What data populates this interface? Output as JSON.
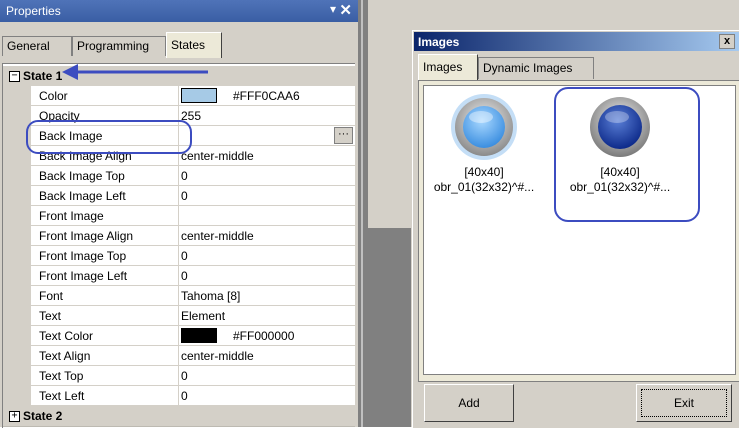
{
  "properties": {
    "title": "Properties",
    "pin_symbol": "▾",
    "close_symbol": "✕",
    "tabs": [
      {
        "label": "General"
      },
      {
        "label": "Programming"
      },
      {
        "label": "States"
      }
    ],
    "state1": {
      "label": "State 1",
      "toggle": "−",
      "rows": [
        {
          "name": "Color",
          "value": "#FFF0CAA6",
          "swatch": "#a6cae6"
        },
        {
          "name": "Opacity",
          "value": "255"
        },
        {
          "name": "Back Image",
          "value": "",
          "button": "···"
        },
        {
          "name": "Back Image Align",
          "value": "center-middle"
        },
        {
          "name": "Back Image Top",
          "value": "0"
        },
        {
          "name": "Back Image Left",
          "value": "0"
        },
        {
          "name": "Front Image",
          "value": ""
        },
        {
          "name": "Front Image Align",
          "value": "center-middle"
        },
        {
          "name": "Front Image Top",
          "value": "0"
        },
        {
          "name": "Front Image Left",
          "value": "0"
        },
        {
          "name": "Font",
          "value": "Tahoma [8]"
        },
        {
          "name": "Text",
          "value": "Element"
        },
        {
          "name": "Text Color",
          "value": "#FF000000",
          "swatch": "#000000"
        },
        {
          "name": "Text Align",
          "value": "center-middle"
        },
        {
          "name": "Text Top",
          "value": "0"
        },
        {
          "name": "Text Left",
          "value": "0"
        }
      ]
    },
    "state2": {
      "label": "State 2",
      "toggle": "+"
    }
  },
  "images": {
    "title": "Images",
    "close_symbol": "x",
    "tabs": [
      {
        "label": "Images"
      },
      {
        "label": "Dynamic Images"
      }
    ],
    "items": [
      {
        "size": "[40x40]",
        "name": "obr_01(32x32)^#...",
        "tone": "light-blue"
      },
      {
        "size": "[40x40]",
        "name": "obr_01(32x32)^#...",
        "tone": "dark-blue"
      }
    ],
    "buttons": {
      "add": "Add",
      "exit": "Exit"
    }
  },
  "colors": {
    "annotation": "#3c4cc0",
    "title_bar": "#3a5ea4"
  }
}
